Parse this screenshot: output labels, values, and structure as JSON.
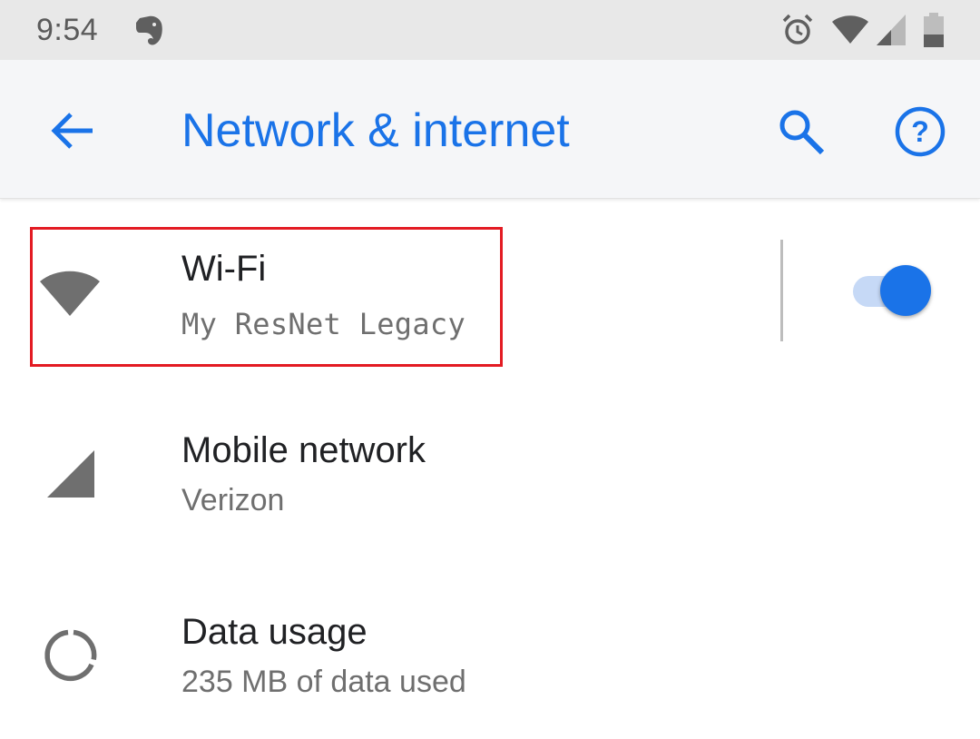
{
  "status_bar": {
    "time": "9:54",
    "icons": [
      "evernote-icon",
      "alarm-icon",
      "wifi-signal-icon",
      "cell-signal-icon",
      "battery-icon"
    ]
  },
  "app_bar": {
    "title": "Network & internet",
    "back_icon": "arrow-back-icon",
    "search_icon": "search-icon",
    "help_icon": "help-icon",
    "accent_color": "#1a73e8"
  },
  "settings": [
    {
      "title": "Wi-Fi",
      "subtitle": "My ResNet Legacy",
      "icon": "wifi-icon",
      "toggle_on": true,
      "highlighted": true
    },
    {
      "title": "Mobile network",
      "subtitle": "Verizon",
      "icon": "cellular-icon"
    },
    {
      "title": "Data usage",
      "subtitle": "235 MB of data used",
      "icon": "data-usage-icon"
    }
  ],
  "colors": {
    "highlight_border": "#e31b23",
    "toggle_thumb": "#1a73e8",
    "toggle_track": "#c6d9f6"
  }
}
